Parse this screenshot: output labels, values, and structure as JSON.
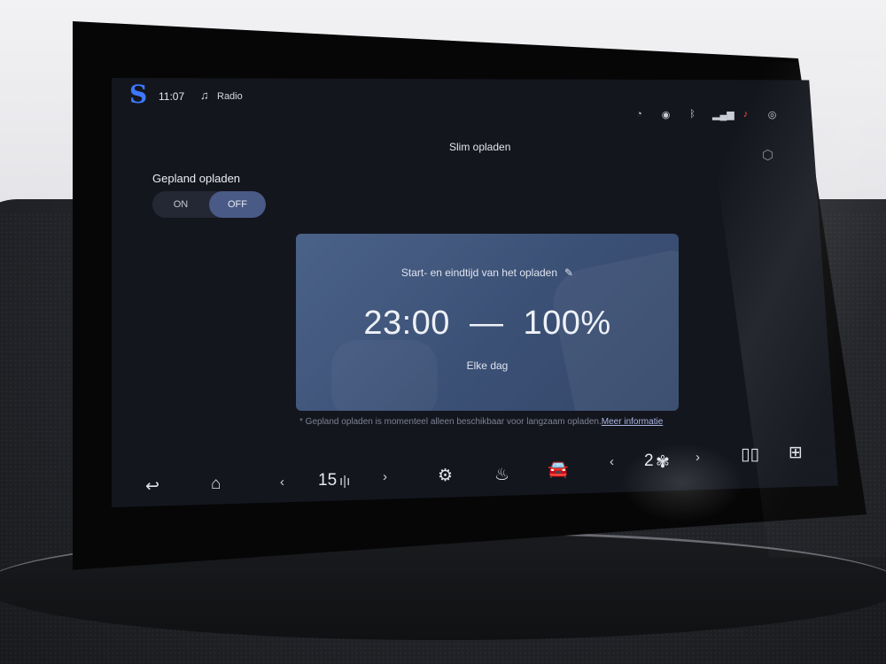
{
  "status_bar": {
    "time": "11:07",
    "media_label": "Radio",
    "icons": [
      "speedometer-icon",
      "location-icon",
      "bluetooth-icon",
      "signal-icon",
      "notification-icon",
      "profile-icon"
    ]
  },
  "page": {
    "title": "Slim opladen",
    "scheduled_label": "Gepland opladen",
    "toggle": {
      "on_label": "ON",
      "off_label": "OFF",
      "selected": "OFF"
    }
  },
  "card": {
    "subtitle": "Start- en eindtijd van het opladen",
    "start_time": "23:00",
    "separator": "—",
    "target_level": "100%",
    "repeat": "Elke dag"
  },
  "note": {
    "text": "* Gepland opladen is momenteel alleen beschikbaar voor langzaam opladen.",
    "link": "Meer informatie"
  },
  "bottom_bar": {
    "volume_level": "15",
    "fan_speed": "2"
  },
  "colors": {
    "screen_bg": "#14161e",
    "card_bg": "#43587e",
    "toggle_active": "#4a5a86",
    "logo": "#3d78ff",
    "alert": "#ff4b4b"
  }
}
